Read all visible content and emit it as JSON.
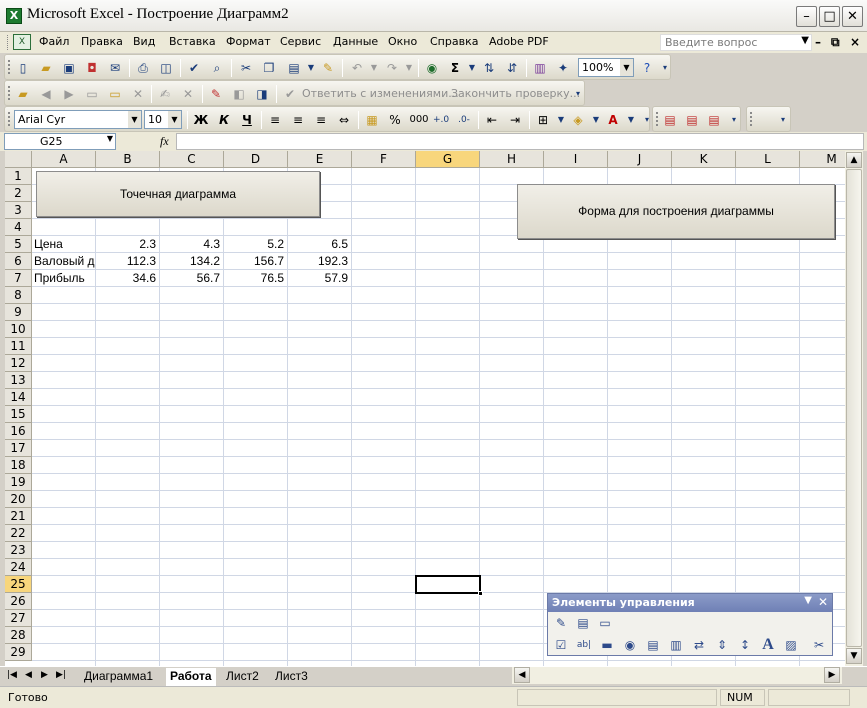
{
  "window": {
    "title": "Microsoft Excel - Построение Диаграмм2",
    "app_icon": "excel-icon"
  },
  "menu": {
    "items": [
      {
        "label": "Файл"
      },
      {
        "label": "Правка"
      },
      {
        "label": "Вид"
      },
      {
        "label": "Вставка"
      },
      {
        "label": "Формат"
      },
      {
        "label": "Сервис"
      },
      {
        "label": "Данные"
      },
      {
        "label": "Окно"
      },
      {
        "label": "Справка"
      },
      {
        "label": "Adobe PDF"
      }
    ],
    "help_placeholder": "Введите вопрос"
  },
  "standard_toolbar": {
    "zoom": "100%"
  },
  "reviewing_toolbar": {
    "reply_label": "Ответить с изменениями...",
    "end_review_label": "Закончить проверку..."
  },
  "formatting_toolbar": {
    "font": "Arial Cyr",
    "size": "10",
    "bold": "Ж",
    "italic": "К",
    "underline": "Ч",
    "percent": "%",
    "thousands": "000"
  },
  "formula_bar": {
    "name_box": "G25",
    "fx": "fx",
    "formula": ""
  },
  "columns": [
    "A",
    "B",
    "C",
    "D",
    "E",
    "F",
    "G",
    "H",
    "I",
    "J",
    "K",
    "L",
    "M"
  ],
  "rows": [
    "1",
    "2",
    "3",
    "4",
    "5",
    "6",
    "7",
    "8",
    "9",
    "10",
    "11",
    "12",
    "13",
    "14",
    "15",
    "16",
    "17",
    "18",
    "19",
    "20",
    "21",
    "22",
    "23",
    "24",
    "25",
    "26",
    "27",
    "28",
    "29"
  ],
  "selected": {
    "column": "G",
    "row": "25"
  },
  "cells": {
    "a5": "Цена",
    "a6": "Валовый доход",
    "a7": "Прибыль",
    "b5": "2.3",
    "c5": "4.3",
    "d5": "5.2",
    "e5": "6.5",
    "b6": "112.3",
    "c6": "134.2",
    "d6": "156.7",
    "e6": "192.3",
    "b7": "34.6",
    "c7": "56.7",
    "d7": "76.5",
    "e7": "57.9"
  },
  "sheet_buttons": {
    "scatter": "Точечная диаграмма",
    "form": "Форма для построения диаграммы"
  },
  "sheet_tabs": [
    {
      "label": "Диаграмма1"
    },
    {
      "label": "Работа"
    },
    {
      "label": "Лист2"
    },
    {
      "label": "Лист3"
    }
  ],
  "active_tab": "Работа",
  "status": {
    "ready": "Готово",
    "num": "NUM"
  },
  "controls_panel": {
    "title": "Элементы управления"
  }
}
